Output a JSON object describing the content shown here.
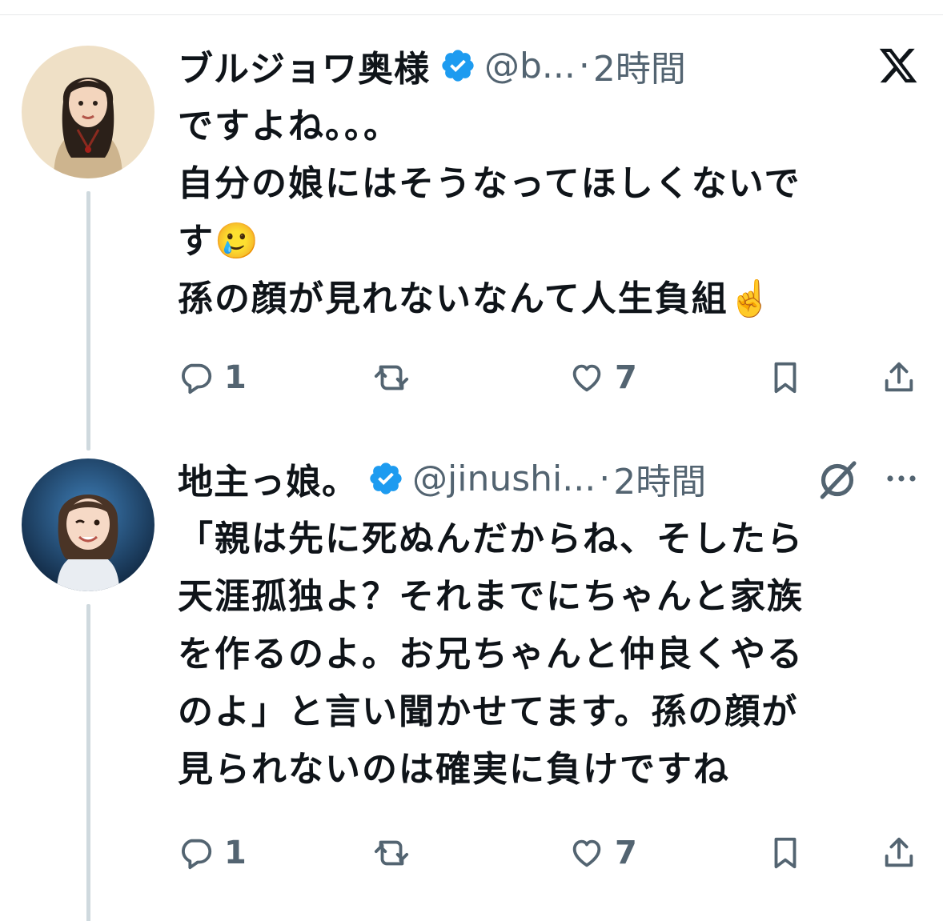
{
  "tweets": [
    {
      "author_name": "ブルジョワ奥様",
      "handle": "@b...",
      "separator": "·",
      "time": "2時間",
      "lines": [
        "ですよね。。。",
        "自分の娘にはそうなってほしくないで",
        "す🥲",
        "孫の顔が見れないなんて人生負組☝️"
      ],
      "replies": "1",
      "likes": "7",
      "corner_icon": "x-logo-icon"
    },
    {
      "author_name": "地主っ娘。",
      "handle": "@jinushi...",
      "separator": "·",
      "time": "2時間",
      "lines": [
        "「親は先に死ぬんだからね、そしたら",
        "天涯孤独よ？それまでにちゃんと家族",
        "を作るのよ。お兄ちゃんと仲良くやる",
        "のよ」と言い聞かせてます。孫の顔が",
        "見られないのは確実に負けですね"
      ],
      "replies": "1",
      "likes": "7",
      "corner_icon": "grok-icon"
    }
  ],
  "colors": {
    "text": "#0f1419",
    "secondary": "#536471",
    "verified": "#1d9bf0",
    "thread_line": "#cfd9de"
  }
}
